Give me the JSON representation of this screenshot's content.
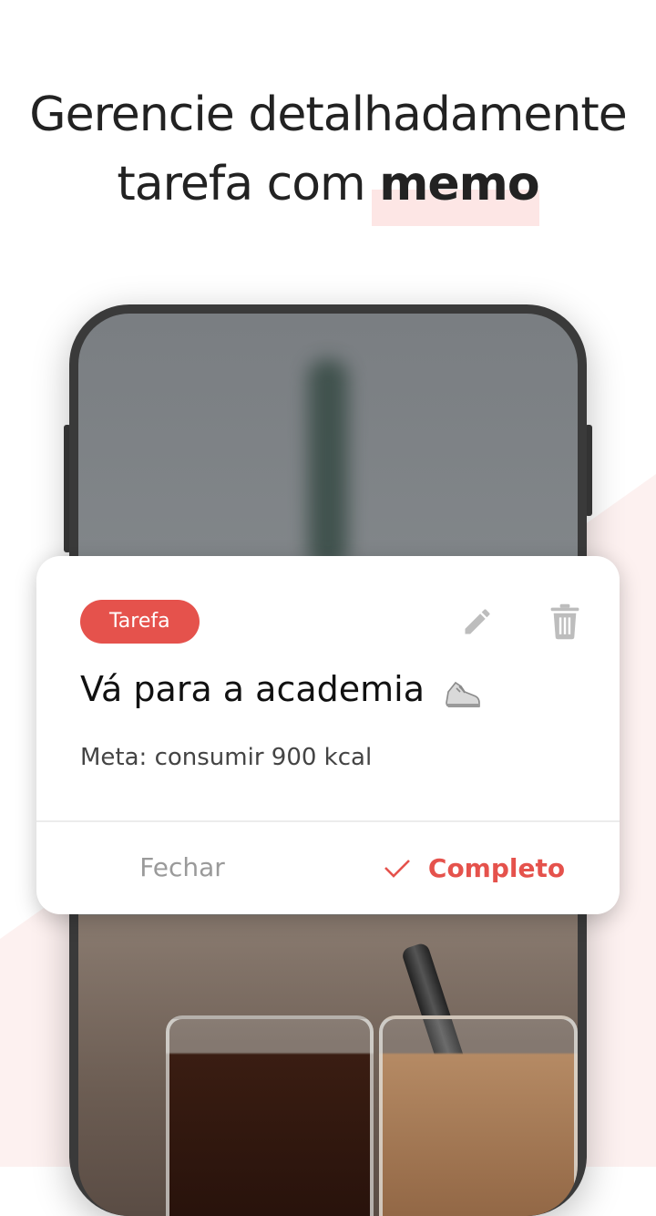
{
  "headline": {
    "line1": "Gerencie detalhadamente",
    "line2_prefix": "tarefa com ",
    "line2_strong": "memo"
  },
  "dialog": {
    "badge": "Tarefa",
    "title": "Vá para a academia",
    "memo": "Meta: consumir 900 kcal",
    "icons": {
      "edit": "pencil-icon",
      "delete": "trash-icon",
      "title_emoji": "sneaker-icon",
      "confirm": "check-icon"
    },
    "close_label": "Fechar",
    "complete_label": "Completo"
  },
  "colors": {
    "accent": "#e5524c",
    "highlight": "#fde6e5",
    "text": "#222222",
    "muted": "#9a9a9a"
  }
}
